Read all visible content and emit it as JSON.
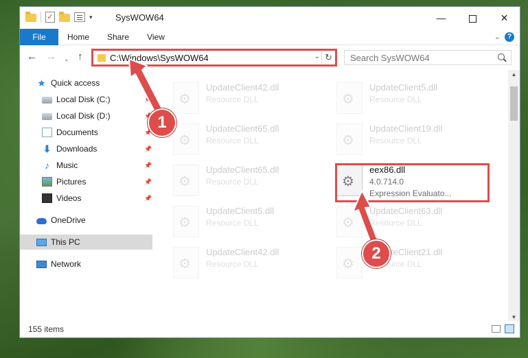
{
  "window": {
    "title": "SysWOW64",
    "min_glyph": "—",
    "close_glyph": "✕"
  },
  "ribbon": {
    "tabs": [
      {
        "label": "File"
      },
      {
        "label": "Home"
      },
      {
        "label": "Share"
      },
      {
        "label": "View"
      }
    ],
    "collapse_glyph": "⌄",
    "help_glyph": "?"
  },
  "navigation": {
    "back_glyph": "←",
    "forward_glyph": "→",
    "recent_glyph": "⌄",
    "up_glyph": "↑",
    "address": "C:\\Windows\\SysWOW64",
    "address_drop_glyph": "⌄",
    "refresh_glyph": "↻",
    "search_placeholder": "Search SysWOW64"
  },
  "sidebar": {
    "items": [
      {
        "label": "Quick access",
        "icon": "star-icon"
      },
      {
        "label": "Local Disk (C:)",
        "icon": "drive-icon",
        "pinned": true
      },
      {
        "label": "Local Disk (D:)",
        "icon": "drive-icon",
        "pinned": true
      },
      {
        "label": "Documents",
        "icon": "documents-icon",
        "pinned": true
      },
      {
        "label": "Downloads",
        "icon": "download-icon",
        "pinned": true
      },
      {
        "label": "Music",
        "icon": "music-icon",
        "pinned": true
      },
      {
        "label": "Pictures",
        "icon": "pictures-icon",
        "pinned": true
      },
      {
        "label": "Videos",
        "icon": "videos-icon",
        "pinned": true
      },
      {
        "label": "OneDrive",
        "icon": "cloud-icon"
      },
      {
        "label": "This PC",
        "icon": "computer-icon",
        "selected": true
      },
      {
        "label": "Network",
        "icon": "network-icon"
      }
    ],
    "pin_glyph": "📌"
  },
  "files": [
    {
      "name": "UpdateClient42.dll",
      "type": "Resource DLL",
      "ghost": true
    },
    {
      "name": "UpdateClient5.dll",
      "type": "Resource DLL",
      "ghost": true
    },
    {
      "name": "UpdateClient65.dll",
      "type": "Resource DLL",
      "ghost": true
    },
    {
      "name": "UpdateClient19.dll",
      "type": "Resource DLL",
      "ghost": true
    },
    {
      "name": "UpdateClient65.dll",
      "type": "Resource DLL",
      "ghost": true
    },
    {
      "name": "eex86.dll",
      "version": "4.0.714.0",
      "type": "Expression Evaluato...",
      "ghost": false
    },
    {
      "name": "UpdateClient5.dll",
      "type": "Resource DLL",
      "ghost": true
    },
    {
      "name": "UpdateClient63.dll",
      "type": "Resource DLL",
      "ghost": true
    },
    {
      "name": "UpdateClient42.dll",
      "type": "Resource DLL",
      "ghost": true
    },
    {
      "name": "UpdateClient21.dll",
      "type": "Resource DLL",
      "ghost": true
    }
  ],
  "status": {
    "item_count": "155 items"
  },
  "scroll": {
    "up_glyph": "▲",
    "down_glyph": "▼"
  },
  "annotations": {
    "step1": "1",
    "step2": "2",
    "color": "#de4c4c"
  }
}
